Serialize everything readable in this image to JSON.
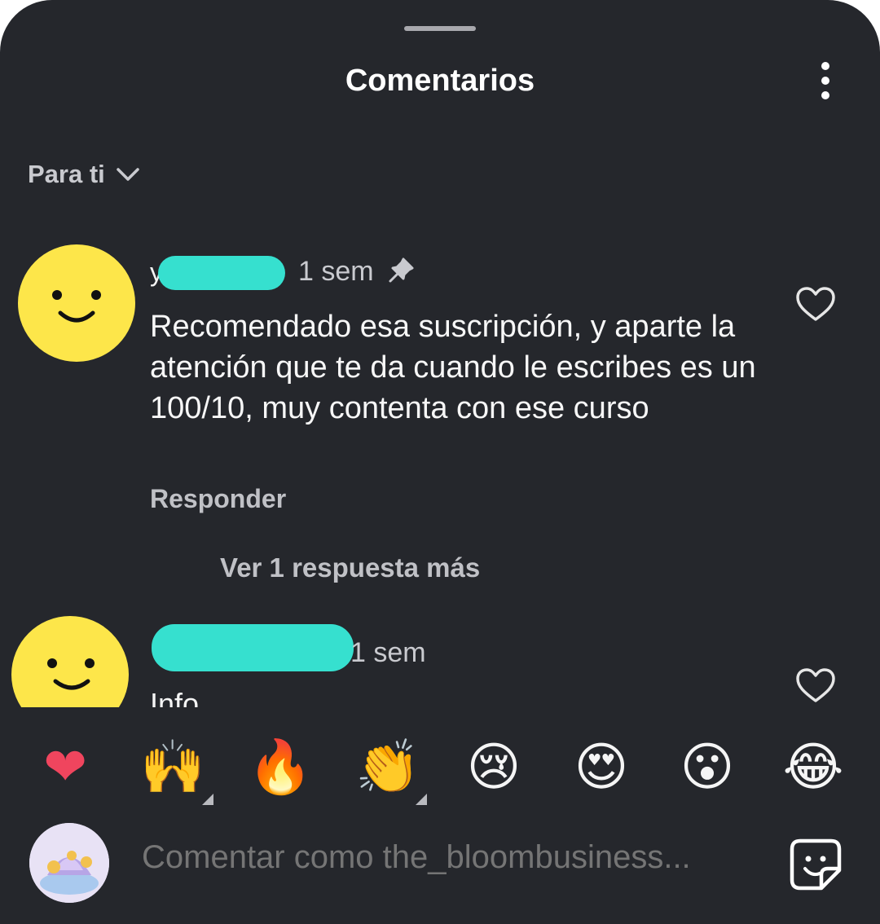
{
  "header": {
    "title": "Comentarios"
  },
  "sort": {
    "label": "Para ti"
  },
  "comments": [
    {
      "username_visible": "y",
      "time": "1 sem",
      "text": "Recomendado esa suscripción, y aparte la atención que te da cuando le escribes es un 100/10, muy contenta con ese curso",
      "reply_label": "Responder",
      "view_replies_label": "Ver 1 respuesta más"
    },
    {
      "time": "1 sem",
      "text_partial": "Info..."
    }
  ],
  "reactions": [
    "❤",
    "🙌",
    "🔥",
    "👏",
    "😢",
    "😍",
    "😮",
    "😂"
  ],
  "compose": {
    "placeholder": "Comentar como the_bloombusiness..."
  },
  "icons": {
    "menu": "more-vertical-icon",
    "sort": "chevron-down-icon",
    "pin": "pin-icon",
    "like": "heart-outline-icon",
    "sticker": "sticker-icon"
  },
  "colors": {
    "background": "#25272c",
    "redaction": "#36e0cf",
    "avatar": "#fde64a"
  }
}
